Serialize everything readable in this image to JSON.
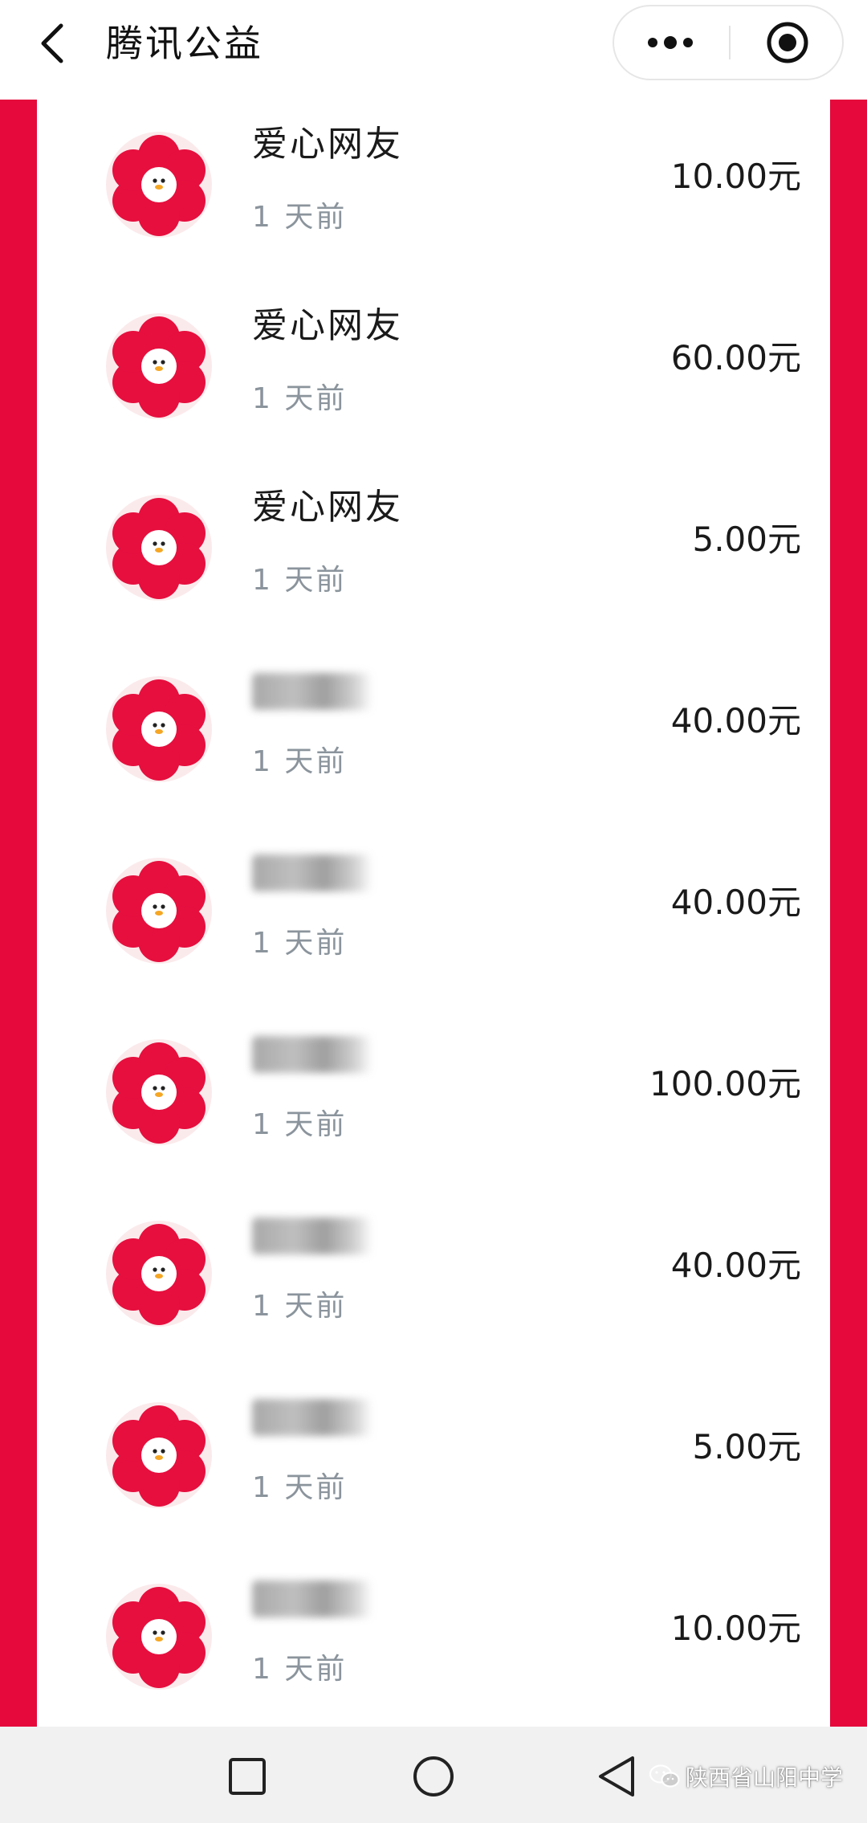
{
  "header": {
    "title": "腾讯公益",
    "back_icon": "chevron-left-icon",
    "more_icon": "more-dots-icon",
    "close_icon": "target-close-icon"
  },
  "colors": {
    "frame_red": "#e5093c",
    "avatar_red": "#e60f3e",
    "time_gray": "#8b949c"
  },
  "donations": [
    {
      "name": "爱心网友",
      "time": "1 天前",
      "amount": "10.00元",
      "name_hidden": false
    },
    {
      "name": "爱心网友",
      "time": "1 天前",
      "amount": "60.00元",
      "name_hidden": false
    },
    {
      "name": "爱心网友",
      "time": "1 天前",
      "amount": "5.00元",
      "name_hidden": false
    },
    {
      "name": "",
      "time": "1 天前",
      "amount": "40.00元",
      "name_hidden": true
    },
    {
      "name": "",
      "time": "1 天前",
      "amount": "40.00元",
      "name_hidden": true
    },
    {
      "name": "",
      "time": "1 天前",
      "amount": "100.00元",
      "name_hidden": true
    },
    {
      "name": "",
      "time": "1 天前",
      "amount": "40.00元",
      "name_hidden": true
    },
    {
      "name": "",
      "time": "1 天前",
      "amount": "5.00元",
      "name_hidden": true
    },
    {
      "name": "",
      "time": "1 天前",
      "amount": "10.00元",
      "name_hidden": true
    }
  ],
  "system_nav": {
    "recents_icon": "square-icon",
    "home_icon": "circle-icon",
    "back_icon": "triangle-back-icon"
  },
  "watermark": {
    "text": "陕西省山阳中学",
    "icon": "wechat-icon"
  }
}
